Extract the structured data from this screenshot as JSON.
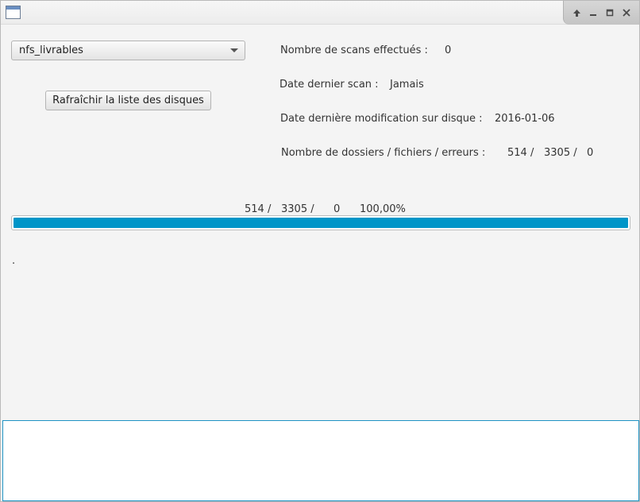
{
  "window": {
    "controls": [
      "maximize-arrow",
      "minimize",
      "restore",
      "close"
    ]
  },
  "disk_selector": {
    "selected": "nfs_livrables"
  },
  "refresh_button": {
    "label": "Rafraîchir la liste des disques"
  },
  "stats": {
    "scans_label": "Nombre de scans effectués :",
    "scans_value": "0",
    "last_scan_label": "Date dernier scan :",
    "last_scan_value": "Jamais",
    "last_mod_label": "Date dernière modification sur disque :",
    "last_mod_value": "2016-01-06",
    "counts_label": "Nombre de dossiers / fichiers / erreurs :",
    "counts_folders": "514 /",
    "counts_files": "3305 /",
    "counts_errors": "0"
  },
  "progress": {
    "folders": "514 /",
    "files": "3305 /",
    "errors": "0",
    "percent_text": "100,00%",
    "fraction": 1.0
  },
  "status_text": ".",
  "log_area": {
    "value": ""
  }
}
